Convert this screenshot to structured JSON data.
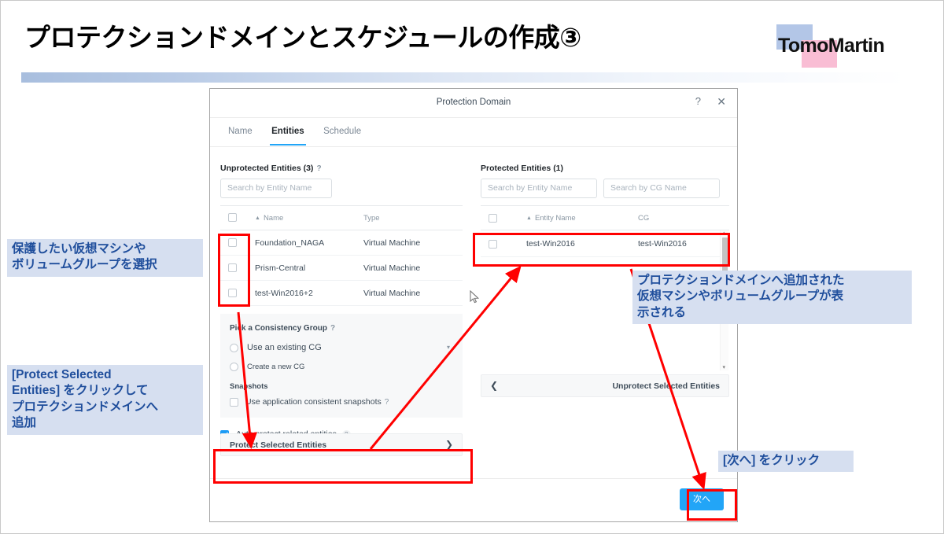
{
  "slide": {
    "title": "プロテクションドメインとスケジュールの作成③",
    "logo_text": "TomoMartin",
    "accent_blue": "#22a5f7",
    "annotation_bg": "#d6dff0",
    "annotation_fg": "#1f4e9c",
    "highlight_red": "#ff0000"
  },
  "dialog": {
    "title": "Protection Domain",
    "help_icon": "?",
    "close_icon": "✕",
    "tabs": [
      {
        "label": "Name",
        "active": false
      },
      {
        "label": "Entities",
        "active": true
      },
      {
        "label": "Schedule",
        "active": false
      }
    ],
    "footer": {
      "next_label": "次へ"
    }
  },
  "unprotected": {
    "heading": "Unprotected Entities (3)",
    "help": "?",
    "search_placeholder": "Search by Entity Name",
    "search_value": "",
    "columns": [
      "",
      "Name",
      "Type"
    ],
    "sort_caret": "▲",
    "rows": [
      {
        "checked": false,
        "name": "Foundation_NAGA",
        "type": "Virtual Machine"
      },
      {
        "checked": false,
        "name": "Prism-Central",
        "type": "Virtual Machine"
      },
      {
        "checked": false,
        "name": "test-Win2016+2",
        "type": "Virtual Machine"
      }
    ],
    "consistency_group": {
      "title": "Pick a Consistency Group",
      "help": "?",
      "options": [
        {
          "label": "Use an existing CG",
          "selected": false
        },
        {
          "label": "Create a new CG",
          "selected": false
        }
      ],
      "dropdown_caret": "▾"
    },
    "snapshots": {
      "title": "Snapshots",
      "checkbox_label": "Use application consistent snapshots",
      "checked": false,
      "help": "?"
    },
    "auto_protect": {
      "label": "Auto protect related entities.",
      "checked": true,
      "help": "?"
    },
    "protect_button": {
      "label": "Protect Selected Entities",
      "arrow": "❯"
    }
  },
  "protected": {
    "heading": "Protected Entities (1)",
    "search_entity_placeholder": "Search by Entity Name",
    "search_cg_placeholder": "Search by CG Name",
    "columns": [
      "",
      "Entity Name",
      "CG"
    ],
    "sort_caret": "▲",
    "rows": [
      {
        "checked": false,
        "entity_name": "test-Win2016",
        "cg": "test-Win2016"
      }
    ],
    "unprotect_button": {
      "label": "Unprotect Selected Entities",
      "arrow": "❮"
    },
    "scrollbar": {
      "up": "▴",
      "down": "▾"
    }
  },
  "annotations": {
    "select_entities": "保護したい仮想マシンや\nボリュームグループを選択",
    "click_protect": "[Protect Selected\nEntities] をクリックして\nプロテクションドメインへ\n追加",
    "displayed": "プロテクションドメインへ追加された\n仮想マシンやボリュームグループが表\n示される",
    "click_next": "[次へ] をクリック"
  }
}
